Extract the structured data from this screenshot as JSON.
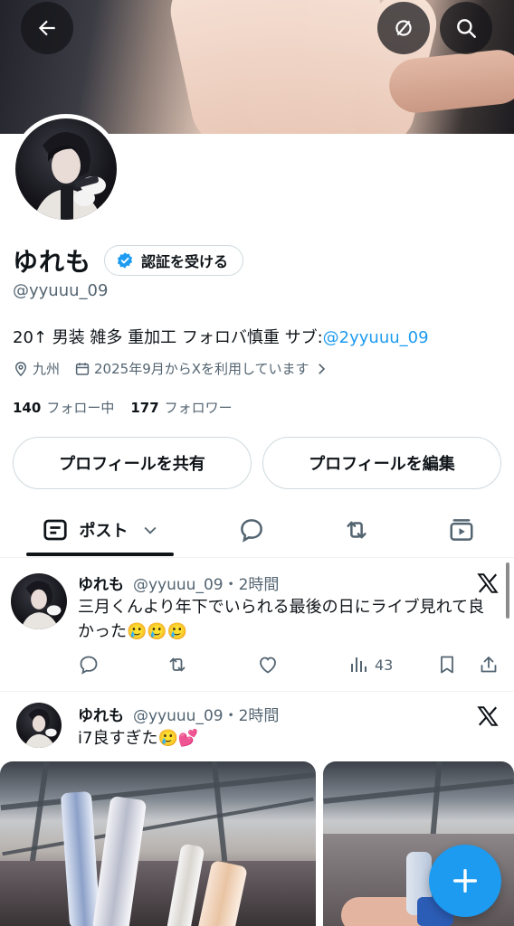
{
  "profile": {
    "display_name": "ゆれも",
    "verify_button": "認証を受ける",
    "handle": "@yyuuu_09",
    "bio_text": "20↑ 男装 雑多 重加工 フォロバ慎重 サブ:",
    "bio_link": "@2yyuuu_09",
    "location": "九州",
    "joined": "2025年9月からXを利用しています",
    "following_count": "140",
    "following_label": "フォロー中",
    "followers_count": "177",
    "followers_label": "フォロワー",
    "share_button": "プロフィールを共有",
    "edit_button": "プロフィールを編集"
  },
  "tabs": {
    "active_label": "ポスト"
  },
  "posts": [
    {
      "name": "ゆれも",
      "meta": "@yyuuu_09・2時間",
      "text": "三月くんより年下でいられる最後の日にライブ見れて良かった🥲🥲🥲",
      "views": "43"
    },
    {
      "name": "ゆれも",
      "meta": "@yyuuu_09・2時間",
      "text": "i7良すぎた🥲💕"
    }
  ],
  "colors": {
    "accent": "#1d9bf0",
    "text": "#0f1419",
    "secondary": "#536471",
    "border": "#cfd9de"
  },
  "icons": [
    "back-arrow-icon",
    "refresh-icon",
    "search-icon",
    "verified-badge-icon",
    "location-pin-icon",
    "calendar-icon",
    "chevron-right-icon",
    "posts-icon",
    "chevron-down-icon",
    "replies-icon",
    "reposts-icon",
    "media-icon",
    "x-logo-icon",
    "reply-icon",
    "repost-icon",
    "like-icon",
    "views-icon",
    "bookmark-icon",
    "share-icon",
    "plus-icon"
  ]
}
